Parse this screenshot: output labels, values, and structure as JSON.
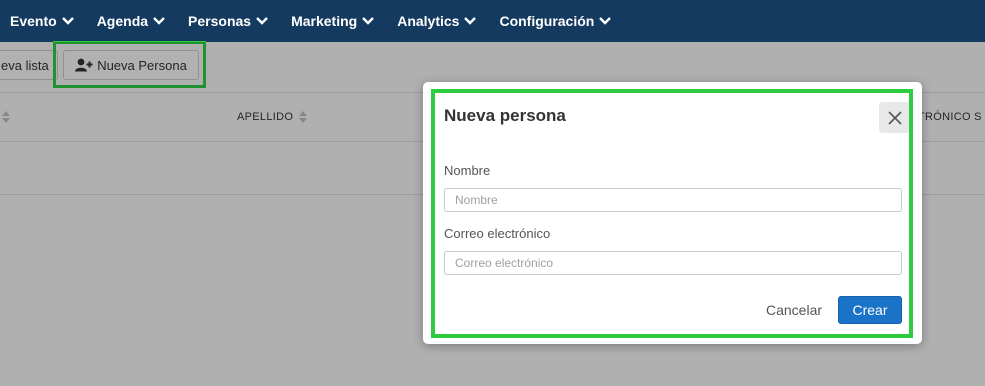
{
  "nav": {
    "items": [
      {
        "label": "Evento"
      },
      {
        "label": "Agenda"
      },
      {
        "label": "Personas"
      },
      {
        "label": "Marketing"
      },
      {
        "label": "Analytics"
      },
      {
        "label": "Configuración"
      }
    ]
  },
  "toolbar": {
    "list_button_label": "eva lista",
    "new_person_button_label": "Nueva Persona"
  },
  "table": {
    "headers": [
      {
        "label": "APELLIDO"
      },
      {
        "label": "TRÓNICO S"
      }
    ]
  },
  "modal": {
    "title": "Nueva persona",
    "name_label": "Nombre",
    "name_placeholder": "Nombre",
    "name_value": "",
    "email_label": "Correo electrónico",
    "email_placeholder": "Correo electrónico",
    "email_value": "",
    "cancel_label": "Cancelar",
    "create_label": "Crear"
  },
  "colors": {
    "nav_bg": "#153a60",
    "primary": "#1b73c8",
    "highlight": "#2ecc40"
  }
}
